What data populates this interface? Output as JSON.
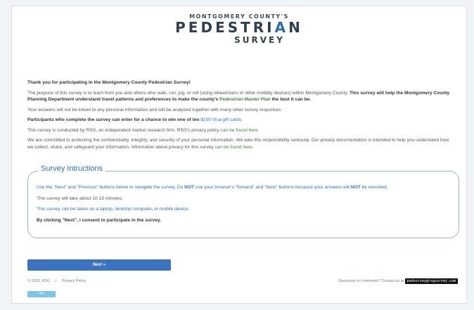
{
  "logo": {
    "top": "MONTGOMERY COUNTY'S",
    "main_a": "PEDESTRI",
    "main_b": "A",
    "main_c": "N",
    "sub": "SURVEY"
  },
  "intro": {
    "thanks": "Thank you for participating in the Montgomery County Pedestrian Survey!",
    "purpose_a": "The purpose of this survey is to learn from you and others who walk, run, jog, or roll (using wheelchairs or other mobility devices) within Montgomery County. ",
    "purpose_b": "This survey will help the Montgomery County Planning Department understand travel patterns and preferences to make the county's ",
    "purpose_link": "Pedestrian Master Plan",
    "purpose_c": " the best it can be.",
    "answers": "Your answers will not be linked to any personal information and will be analyzed together with many other survey responses.",
    "participants_a": "Participants who complete the survey can enter for a chance to win one of ten ",
    "participants_link": "$100 Visa gift cards.",
    "rsg_a": "This survey is conducted by RSG, an independent market research firm. RSG's privacy policy ",
    "rsg_link": "can be found here.",
    "privacy_a": "We are committed to protecting the confidentiality, integrity, and security of your personal information. We take this responsibility seriously. Our privacy documentation is intended to help you understand how we collect, share, and safeguard your information. Information about privacy for this survey ",
    "privacy_link": "can be found here."
  },
  "instructions": {
    "legend": "Survey Intructions",
    "nav_a": "Use the \"Next\" and \"Previous\" buttons below to navigate the survey. Do ",
    "nav_not1": "NOT",
    "nav_b": " use your browser's \"forward\" and \"back\" buttons because your answers will ",
    "nav_not2": "NOT",
    "nav_c": " be recorded.",
    "time": "This survey will take about 10-15 minutes.",
    "devices": "This survey can be taken on a laptop, desktop computer, or mobile device.",
    "consent": "By clicking \"Next\", I consent to participate in the survey."
  },
  "next_label": "Next »",
  "footer": {
    "copyright": "© 2020, RSG",
    "sep": "|",
    "privacy": "Privacy Policy",
    "questions": "Questions or comments? Contact us at",
    "email": "pedsurvey@rsgsurvey.com"
  },
  "progress": {
    "label": "0%",
    "value": 0
  }
}
